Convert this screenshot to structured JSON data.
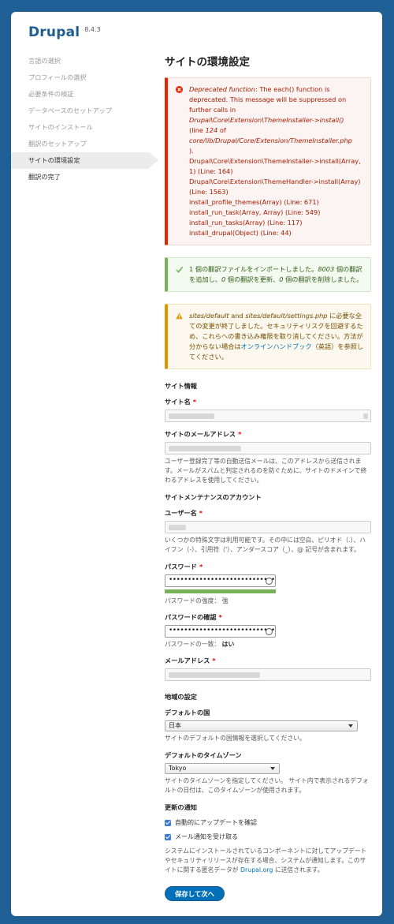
{
  "brand": {
    "name": "Drupal",
    "version": "8.4.3"
  },
  "steps": [
    {
      "label": "言語の選択",
      "state": "done"
    },
    {
      "label": "プロフィールの選択",
      "state": "done"
    },
    {
      "label": "必要条件の検証",
      "state": "done"
    },
    {
      "label": "データベースのセットアップ",
      "state": "done"
    },
    {
      "label": "サイトのインストール",
      "state": "done"
    },
    {
      "label": "翻訳のセットアップ",
      "state": "done"
    },
    {
      "label": "サイトの環境設定",
      "state": "active"
    },
    {
      "label": "翻訳の完了",
      "state": "pending"
    }
  ],
  "page_title": "サイトの環境設定",
  "error": {
    "icon": "error-x-icon",
    "heading_em": "Deprecated function",
    "heading_rest": ": The each() function is deprecated. This message will be suppressed on further calls in",
    "path_em": "Drupal\\Core\\Extension\\ThemeInstaller->install()",
    "line_prefix": "(line",
    "line_no": "124",
    "line_of": "of",
    "file_em": "core/lib/Drupal/Core/Extension/ThemeInstaller.php",
    "end": ").",
    "trace": [
      "Drupal\\Core\\Extension\\ThemeInstaller->install(Array, 1) (Line: 164)",
      "Drupal\\Core\\Extension\\ThemeHandler->install(Array) (Line: 1563)",
      "install_profile_themes(Array) (Line: 671)",
      "install_run_task(Array, Array) (Line: 549)",
      "install_run_tasks(Array) (Line: 117)",
      "install_drupal(Object) (Line: 44)"
    ]
  },
  "status": {
    "icon": "check-icon",
    "t1": "1 個の翻訳ファイルをインポートしました。",
    "n1": "8003",
    "t2": " 個の翻訳を追加し、",
    "n2": "0",
    "t3": " 個の翻訳を更新、",
    "n3": "0",
    "t4": " 個の翻訳を削除しました。"
  },
  "warning": {
    "icon": "warning-icon",
    "p1": "sites/default",
    "t1": " and ",
    "p2": "sites/default/settings.php",
    "t2": " に必要な全ての変更が終了しました。セキュリティリスクを回避するため、これらへの書き込み権限を取り消してください。方法が分からない場合は",
    "link": "オンラインハンドブック",
    "t3": "（英語）を参照してください。"
  },
  "site_info": {
    "title": "サイト情報",
    "name_label": "サイト名",
    "email_label": "サイトのメールアドレス",
    "email_help": "ユーザー登録完了等の自動送信メールは、このアドレスから送信されます。メールがスパムと判定されるのを防ぐために、サイトのドメインで終わるアドレスを使用してください。"
  },
  "account": {
    "title": "サイトメンテナンスのアカウント",
    "username_label": "ユーザー名",
    "username_help": "いくつかの特殊文字は利用可能です。その中には空白、ピリオド（.）、ハイフン（-）、引用符（'）、アンダースコア（_）、@ 記号が含まれます。",
    "password_label": "パスワード",
    "password_mask": "••••••••••••••••••••••••••••••••",
    "strength_label": "パスワードの強度：",
    "strength_value": "強",
    "confirm_label": "パスワードの確認",
    "match_label": "パスワードの一致：",
    "match_value": "はい",
    "email_label": "メールアドレス"
  },
  "regional": {
    "title": "地域の設定",
    "country_label": "デフォルトの国",
    "country_value": "日本",
    "country_help": "サイトのデフォルトの国情報を選択してください。",
    "tz_label": "デフォルトのタイムゾーン",
    "tz_value": "Tokyo",
    "tz_help": "サイトのタイムゾーンを指定してください。 サイト内で表示されるデフォルトの日付は、このタイムゾーンが使用されます。"
  },
  "updates": {
    "title": "更新の通知",
    "check_label": "自動的にアップデートを確認",
    "email_label": "メール通知を受け取る",
    "help1": "システムにインストールされているコンポーネントに対してアップデートやセキュリティリリースが存在する場合、システムが通知します。このサイトに関する匿名データが ",
    "help_link": "Drupal.org",
    "help2": " に送信されます。"
  },
  "submit_label": "保存して次へ",
  "colors": {
    "accent": "#0071b8",
    "brand": "#1d5d90",
    "error": "#e62600",
    "status": "#77b259",
    "warning": "#e09600"
  }
}
